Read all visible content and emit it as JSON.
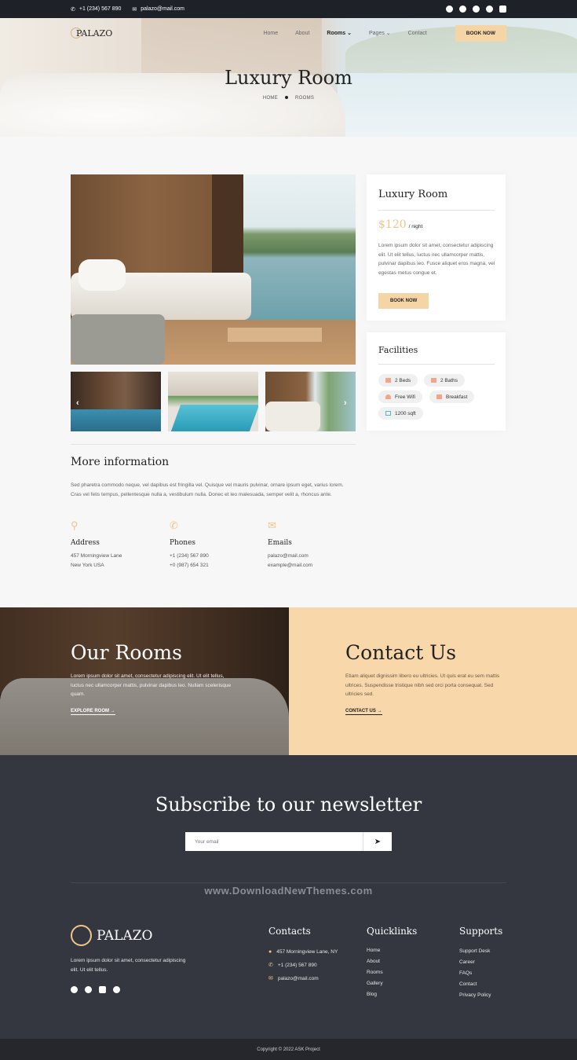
{
  "topbar": {
    "phone": "+1 (234) 567 890",
    "email": "palazo@mail.com",
    "socials": [
      "facebook-icon",
      "twitter-icon",
      "youtube-icon",
      "instagram-icon",
      "linkedin-icon"
    ]
  },
  "nav": {
    "logo": "PALAZO",
    "items": [
      {
        "label": "Home"
      },
      {
        "label": "About"
      },
      {
        "label": "Rooms"
      },
      {
        "label": "Pages"
      },
      {
        "label": "Contact"
      }
    ],
    "book": "BOOK NOW"
  },
  "hero": {
    "title": "Luxury Room",
    "crumb_home": "HOME",
    "crumb_current": "ROOMS"
  },
  "room": {
    "title": "Luxury Room",
    "price": "$120",
    "per": "/ night",
    "desc": "Lorem ipsum dolor sit amet, consectetur adipiscing elit. Ut elit tellus, luctus nec ullamcorper mattis, pulvinar dapibus leo. Fusce aliquet eros magna, vel egestas metus congue et.",
    "book": "BOOK NOW"
  },
  "facilities": {
    "title": "Facilities",
    "items": [
      {
        "label": "2 Beds",
        "icon": "bed-icon"
      },
      {
        "label": "2 Baths",
        "icon": "bath-icon"
      },
      {
        "label": "Free Wifi",
        "icon": "wifi-icon"
      },
      {
        "label": "Breakfast",
        "icon": "breakfast-icon"
      },
      {
        "label": "1200 sqft",
        "icon": "area-icon"
      }
    ]
  },
  "more": {
    "title": "More information",
    "text": "Sed pharetra commodo neque, vel dapibus est fringilla vel. Quisque vel mauris pulvinar, ornare ipsum eget, varius lorem. Cras vel felis tempus, pellentesque nulla a, vestibulum nulla. Donec et leo malesuada, semper velit a, rhoncus ante.",
    "address": {
      "title": "Address",
      "line1": "457 Morningview Lane",
      "line2": "New York USA"
    },
    "phones": {
      "title": "Phones",
      "line1": "+1 (234) 567 890",
      "line2": "+0 (987) 654 321"
    },
    "emails": {
      "title": "Emails",
      "line1": "palazo@mail.com",
      "line2": "example@mail.com"
    }
  },
  "rooms_promo": {
    "title": "Our Rooms",
    "text": "Lorem ipsum dolor sit amet, consectetur adipiscing elit. Ut elit tellus, luctus nec ullamcorper mattis, pulvinar dapibus leo. Nullam scelerisque quam.",
    "link": "EXPLORE ROOM"
  },
  "contact_promo": {
    "title": "Contact Us",
    "text": "Etiam aliquet dignissim libero eu ultricies. Ut quis erat eu sem mattis ultrices. Suspendisse tristique nibh sed orci porta consequat. Sed ultricies sed.",
    "link": "CONTACT US"
  },
  "newsletter": {
    "title": "Subscribe to our newsletter",
    "placeholder": "Your email"
  },
  "watermark": "www.DownloadNewThemes.com",
  "footer": {
    "logo": "PALAZO",
    "about": "Lorem ipsum dolor sit amet, consectetur adipiscing elit. Ut elit tellus.",
    "contacts": {
      "title": "Contacts",
      "address": "457 Morningview Lane, NY",
      "phone": "+1 (234) 567 890",
      "email": "palazo@mail.com"
    },
    "quicklinks": {
      "title": "Quicklinks",
      "items": [
        "Home",
        "About",
        "Rooms",
        "Gallery",
        "Blog"
      ]
    },
    "supports": {
      "title": "Supports",
      "items": [
        "Support Desk",
        "Career",
        "FAQs",
        "Contact",
        "Privacy Policy"
      ]
    },
    "copyright": "Copyright © 2022 ASK Project"
  },
  "colors": {
    "accent": "#f5d5a6",
    "dark": "#343740",
    "topbar": "#1f2128"
  }
}
